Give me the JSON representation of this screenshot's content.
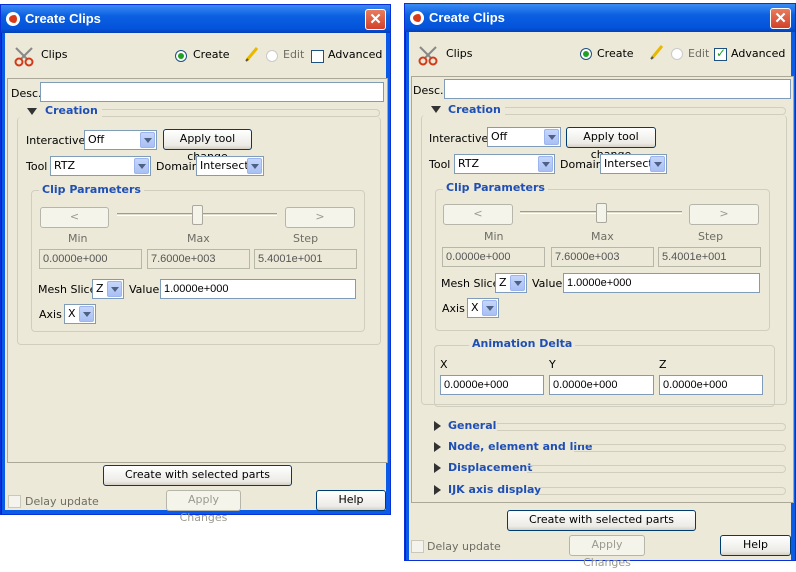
{
  "left": {
    "title": "Create Clips",
    "header": {
      "section": "Clips",
      "create": "Create",
      "edit": "Edit",
      "advanced": "Advanced"
    },
    "desc_label": "Desc.",
    "desc_value": "",
    "creation": {
      "title": "Creation",
      "interactive_label": "Interactive",
      "interactive_value": "Off",
      "apply_tool": "Apply tool change",
      "tool_label": "Tool",
      "tool_value": "RTZ",
      "domain_label": "Domain",
      "domain_value": "Intersect"
    },
    "params": {
      "title": "Clip Parameters",
      "prev": "<",
      "next": ">",
      "min_label": "Min",
      "max_label": "Max",
      "step_label": "Step",
      "min_value": "0.0000e+000",
      "max_value": "7.6000e+003",
      "step_value": "5.4001e+001",
      "mesh_label": "Mesh Slice",
      "mesh_value": "Z",
      "value_label": "Value",
      "value_value": "1.0000e+000",
      "axis_label": "Axis",
      "axis_value": "X",
      "slider_pos": 0.5
    },
    "footer": {
      "create": "Create with selected parts",
      "delay": "Delay update",
      "apply": "Apply Changes",
      "help": "Help"
    }
  },
  "right": {
    "title": "Create Clips",
    "header": {
      "section": "Clips",
      "create": "Create",
      "edit": "Edit",
      "advanced": "Advanced"
    },
    "desc_label": "Desc.",
    "desc_value": "",
    "creation": {
      "title": "Creation",
      "interactive_label": "Interactive",
      "interactive_value": "Off",
      "apply_tool": "Apply tool change",
      "tool_label": "Tool",
      "tool_value": "RTZ",
      "domain_label": "Domain",
      "domain_value": "Intersect"
    },
    "params": {
      "title": "Clip Parameters",
      "prev": "<",
      "next": ">",
      "min_label": "Min",
      "max_label": "Max",
      "step_label": "Step",
      "min_value": "0.0000e+000",
      "max_value": "7.6000e+003",
      "step_value": "5.4001e+001",
      "mesh_label": "Mesh Slice",
      "mesh_value": "Z",
      "value_label": "Value",
      "value_value": "1.0000e+000",
      "axis_label": "Axis",
      "axis_value": "X",
      "slider_pos": 0.5
    },
    "anim": {
      "title": "Animation Delta",
      "x_label": "X",
      "y_label": "Y",
      "z_label": "Z",
      "x_value": "0.0000e+000",
      "y_value": "0.0000e+000",
      "z_value": "0.0000e+000"
    },
    "sections": [
      "General",
      "Node, element and line",
      "Displacement",
      "IJK axis display"
    ],
    "footer": {
      "create": "Create with selected parts",
      "delay": "Delay update",
      "apply": "Apply Changes",
      "help": "Help"
    }
  }
}
